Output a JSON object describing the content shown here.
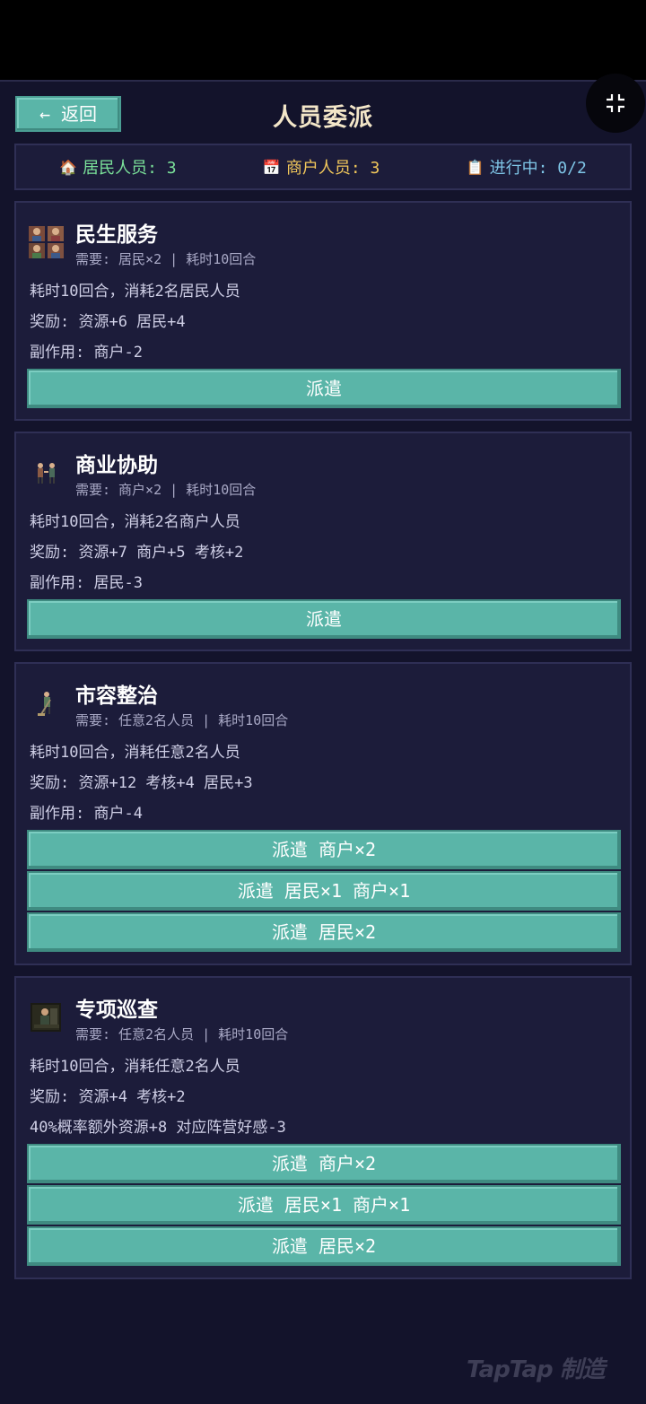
{
  "header": {
    "back_label": "← 返回",
    "title": "人员委派"
  },
  "stats": {
    "residents": {
      "icon": "house-icon",
      "emoji": "🏠",
      "text": "居民人员: 3"
    },
    "merchants": {
      "icon": "calendar-icon",
      "emoji": "📅",
      "text": "商户人员: 3"
    },
    "in_progress": {
      "icon": "clipboard-icon",
      "emoji": "📋",
      "text": "进行中: 0/2"
    }
  },
  "fab": {
    "icon": "collapse-icon"
  },
  "missions": [
    {
      "title": "民生服务",
      "icon": "people-service-icon",
      "meta": "需要: 居民×2 | 耗时10回合",
      "desc": "耗时10回合，消耗2名居民人员",
      "reward": "奖励: 资源+6 居民+4",
      "side": "副作用: 商户-2",
      "buttons": [
        "派遣"
      ]
    },
    {
      "title": "商业协助",
      "icon": "merchants-icon",
      "meta": "需要: 商户×2 | 耗时10回合",
      "desc": "耗时10回合，消耗2名商户人员",
      "reward": "奖励: 资源+7 商户+5 考核+2",
      "side": "副作用: 居民-3",
      "buttons": [
        "派遣"
      ]
    },
    {
      "title": "市容整治",
      "icon": "sweeper-icon",
      "meta": "需要: 任意2名人员 | 耗时10回合",
      "desc": "耗时10回合，消耗任意2名人员",
      "reward": "奖励: 资源+12 考核+4 居民+3",
      "side": "副作用: 商户-4",
      "buttons": [
        "派遣 商户×2",
        "派遣 居民×1 商户×1",
        "派遣 居民×2"
      ]
    },
    {
      "title": "专项巡查",
      "icon": "patrol-icon",
      "meta": "需要: 任意2名人员 | 耗时10回合",
      "desc": "耗时10回合，消耗任意2名人员",
      "reward": "奖励: 资源+4 考核+2",
      "side": "40%概率额外资源+8 对应阵营好感-3",
      "buttons": [
        "派遣 商户×2",
        "派遣 居民×1 商户×1",
        "派遣 居民×2"
      ]
    }
  ],
  "watermark": {
    "text": "TapTap 制造"
  },
  "colors": {
    "background": "#13132b",
    "card": "#1c1c3a",
    "button": "#5ab5a8",
    "title": "#f3e6c8",
    "residents": "#7be29a",
    "merchants": "#f2c85b",
    "progress": "#7fc6e8"
  }
}
